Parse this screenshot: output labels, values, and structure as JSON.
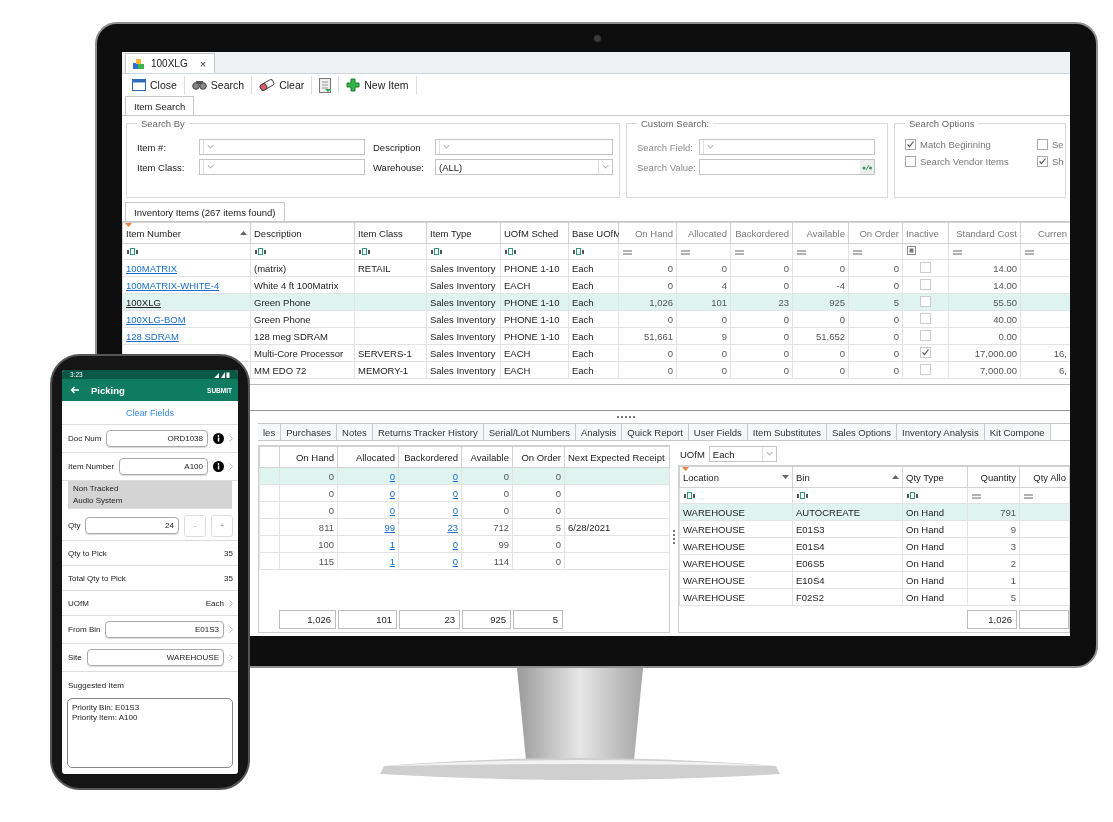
{
  "desktop": {
    "document_tab": {
      "label": "100XLG",
      "close": "×"
    },
    "toolbar": [
      {
        "kind": "close",
        "label": "Close"
      },
      {
        "kind": "search",
        "label": "Search"
      },
      {
        "kind": "clear",
        "label": "Clear"
      },
      {
        "kind": "report"
      },
      {
        "kind": "new",
        "label": "New Item"
      }
    ],
    "search_tab": {
      "label": "Item Search",
      "selected": true
    },
    "search_by": {
      "title": "Search By",
      "fields": [
        {
          "label": "Item #:"
        },
        {
          "label": "Description"
        },
        {
          "label": "Item Class:"
        },
        {
          "label": "Warehouse:",
          "value": "(ALL)"
        }
      ]
    },
    "custom_search": {
      "title": "Custom Search:",
      "disabled": true,
      "fields": [
        {
          "label": "Search Field:",
          "kind": "combo"
        },
        {
          "label": "Search Value:",
          "kind": "wildcard"
        }
      ]
    },
    "search_options": {
      "title": "Search Options",
      "options": [
        {
          "label": "Match Beginning",
          "checked": true
        },
        {
          "label": "Se",
          "checked": false
        },
        {
          "label": "Search Vendor Items",
          "checked": false
        },
        {
          "label": "Sh",
          "checked": true
        }
      ]
    },
    "items_grid": {
      "tab": {
        "label": "Inventory Items (267 items found)",
        "selected": true
      },
      "filter_row": true,
      "columns": [
        {
          "label": "Item Number",
          "kind": "link",
          "sort_up": true,
          "filtered": true
        },
        {
          "label": "Description",
          "kind": "text"
        },
        {
          "label": "Item Class",
          "kind": "text"
        },
        {
          "label": "Item Type",
          "kind": "text"
        },
        {
          "label": "UOfM Sched",
          "kind": "text"
        },
        {
          "label": "Base UOfM",
          "kind": "text"
        },
        {
          "label": "On Hand",
          "kind": "number"
        },
        {
          "label": "Allocated",
          "kind": "number"
        },
        {
          "label": "Backordered",
          "kind": "number"
        },
        {
          "label": "Available",
          "kind": "number"
        },
        {
          "label": "On Order",
          "kind": "number"
        },
        {
          "label": "Inactive",
          "kind": "check"
        },
        {
          "label": "Standard Cost",
          "kind": "number"
        },
        {
          "label": "Curren",
          "kind": "number"
        }
      ],
      "rows": [
        {
          "selected": false,
          "cells": [
            "100MATRIX",
            "(matrix)",
            "RETAIL",
            "Sales Inventory",
            "PHONE 1-10",
            "Each",
            "0",
            "0",
            "0",
            "0",
            "0",
            false,
            "14.00",
            null
          ]
        },
        {
          "selected": false,
          "cells": [
            "100MATRIX-WHITE-4",
            "White 4 ft 100Matrix",
            null,
            "Sales Inventory",
            "EACH",
            "Each",
            "0",
            "4",
            "0",
            "-4",
            "0",
            false,
            "14.00",
            null
          ]
        },
        {
          "selected": true,
          "cells": [
            "100XLG",
            "Green Phone",
            null,
            "Sales Inventory",
            "PHONE 1-10",
            "Each",
            "1,026",
            "101",
            "23",
            "925",
            "5",
            false,
            "55.50",
            null
          ]
        },
        {
          "selected": false,
          "cells": [
            "100XLG-BOM",
            "Green Phone",
            null,
            "Sales Inventory",
            "PHONE 1-10",
            "Each",
            "0",
            "0",
            "0",
            "0",
            "0",
            false,
            "40.00",
            null
          ]
        },
        {
          "selected": false,
          "cells": [
            "128 SDRAM",
            "128 meg SDRAM",
            null,
            "Sales Inventory",
            "PHONE 1-10",
            "Each",
            "51,661",
            "9",
            "0",
            "51,652",
            "0",
            false,
            "0.00",
            null
          ]
        },
        {
          "selected": false,
          "cells": [
            null,
            "Multi-Core Processor",
            "SERVERS-1",
            "Sales Inventory",
            "EACH",
            "Each",
            "0",
            "0",
            "0",
            "0",
            "0",
            true,
            "17,000.00",
            "16,"
          ]
        },
        {
          "selected": false,
          "cells": [
            null,
            "MM EDO 72",
            "MEMORY-1",
            "Sales Inventory",
            "EACH",
            "Each",
            "0",
            "0",
            "0",
            "0",
            "0",
            false,
            "7,000.00",
            "6,"
          ]
        }
      ]
    },
    "detail_tabs": [
      {
        "label": "les",
        "selected": false
      },
      {
        "label": "Purchases",
        "selected": false
      },
      {
        "label": "Notes",
        "selected": false
      },
      {
        "label": "Returns Tracker History",
        "selected": false
      },
      {
        "label": "Serial/Lot Numbers",
        "selected": false
      },
      {
        "label": "Analysis",
        "selected": false
      },
      {
        "label": "Quick Report",
        "selected": false
      },
      {
        "label": "User Fields",
        "selected": false
      },
      {
        "label": "Item Substitutes",
        "selected": false
      },
      {
        "label": "Sales Options",
        "selected": false
      },
      {
        "label": "Inventory Analysis",
        "selected": false
      },
      {
        "label": "Kit Compone",
        "selected": false
      }
    ],
    "stock_grid": {
      "filter_row": false,
      "columns": [
        {
          "label": "On Hand",
          "kind": "number"
        },
        {
          "label": "Allocated",
          "kind": "link_number"
        },
        {
          "label": "Backordered",
          "kind": "link_number"
        },
        {
          "label": "Available",
          "kind": "number"
        },
        {
          "label": "On Order",
          "kind": "number"
        },
        {
          "label": "Next Expected Receipt",
          "kind": "text"
        }
      ],
      "rows": [
        {
          "selected": true,
          "cells": [
            "0",
            "0",
            "0",
            "0",
            "0",
            null
          ]
        },
        {
          "selected": false,
          "cells": [
            "0",
            "0",
            "0",
            "0",
            "0",
            null
          ]
        },
        {
          "selected": false,
          "cells": [
            "0",
            "0",
            "0",
            "0",
            "0",
            null
          ]
        },
        {
          "selected": false,
          "cells": [
            "811",
            "99",
            "23",
            "712",
            "5",
            "6/28/2021"
          ]
        },
        {
          "selected": false,
          "cells": [
            "100",
            "1",
            "0",
            "99",
            "0",
            null
          ]
        },
        {
          "selected": false,
          "cells": [
            "115",
            "1",
            "0",
            "114",
            "0",
            null
          ]
        }
      ],
      "totals": [
        "1,026",
        "101",
        "23",
        "925",
        "5"
      ]
    },
    "bin_grid": {
      "uofm": {
        "label": "UOfM",
        "value": "Each"
      },
      "filter_row": true,
      "columns": [
        {
          "label": "Location",
          "kind": "text",
          "sort_down": true,
          "filtered": true
        },
        {
          "label": "Bin",
          "kind": "text",
          "sort_up": true
        },
        {
          "label": "Qty Type",
          "kind": "text"
        },
        {
          "label": "Quantity",
          "kind": "number"
        },
        {
          "label": "Qty Allo",
          "kind": "number"
        }
      ],
      "rows": [
        {
          "selected": true,
          "cells": [
            "WAREHOUSE",
            "AUTOCREATE",
            "On Hand",
            "791",
            null
          ]
        },
        {
          "selected": false,
          "cells": [
            "WAREHOUSE",
            "E01S3",
            "On Hand",
            "9",
            null
          ]
        },
        {
          "selected": false,
          "cells": [
            "WAREHOUSE",
            "E01S4",
            "On Hand",
            "3",
            null
          ]
        },
        {
          "selected": false,
          "cells": [
            "WAREHOUSE",
            "E06S5",
            "On Hand",
            "2",
            null
          ]
        },
        {
          "selected": false,
          "cells": [
            "WAREHOUSE",
            "E10S4",
            "On Hand",
            "1",
            null
          ]
        },
        {
          "selected": false,
          "cells": [
            "WAREHOUSE",
            "F02S2",
            "On Hand",
            "5",
            null
          ]
        }
      ],
      "totals": [
        "1,026"
      ]
    }
  },
  "phone": {
    "time": "3:23",
    "title": "Picking",
    "action": "SUBMIT",
    "clear": "Clear Fields",
    "rows": [
      {
        "kind": "field",
        "label": "Doc Num",
        "value": "ORD1038",
        "info": true,
        "chevron": true
      },
      {
        "kind": "field",
        "label": "Item Number",
        "value": "A100",
        "info": true,
        "chevron": true
      },
      {
        "kind": "note",
        "lines": [
          "Non Tracked",
          "Audio System"
        ]
      },
      {
        "kind": "stepper",
        "label": "Qty",
        "value": "24",
        "minus": "-",
        "plus": "+"
      },
      {
        "kind": "value",
        "label": "Qty to Pick",
        "value": "35",
        "chevron": false
      },
      {
        "kind": "value",
        "label": "Total Qty to Pick",
        "value": "35",
        "chevron": false
      },
      {
        "kind": "value",
        "label": "UOfM",
        "value": "Each",
        "chevron": true
      },
      {
        "kind": "field",
        "label": "From Bin",
        "value": "E01S3",
        "info": false,
        "chevron": true
      },
      {
        "kind": "field",
        "label": "Site",
        "value": "WAREHOUSE",
        "info": false,
        "chevron": true
      },
      {
        "kind": "heading",
        "label": "Suggested Item"
      },
      {
        "kind": "memo",
        "lines": [
          "Priority Bin: E01S3",
          "Priority Item: A100"
        ]
      }
    ]
  }
}
